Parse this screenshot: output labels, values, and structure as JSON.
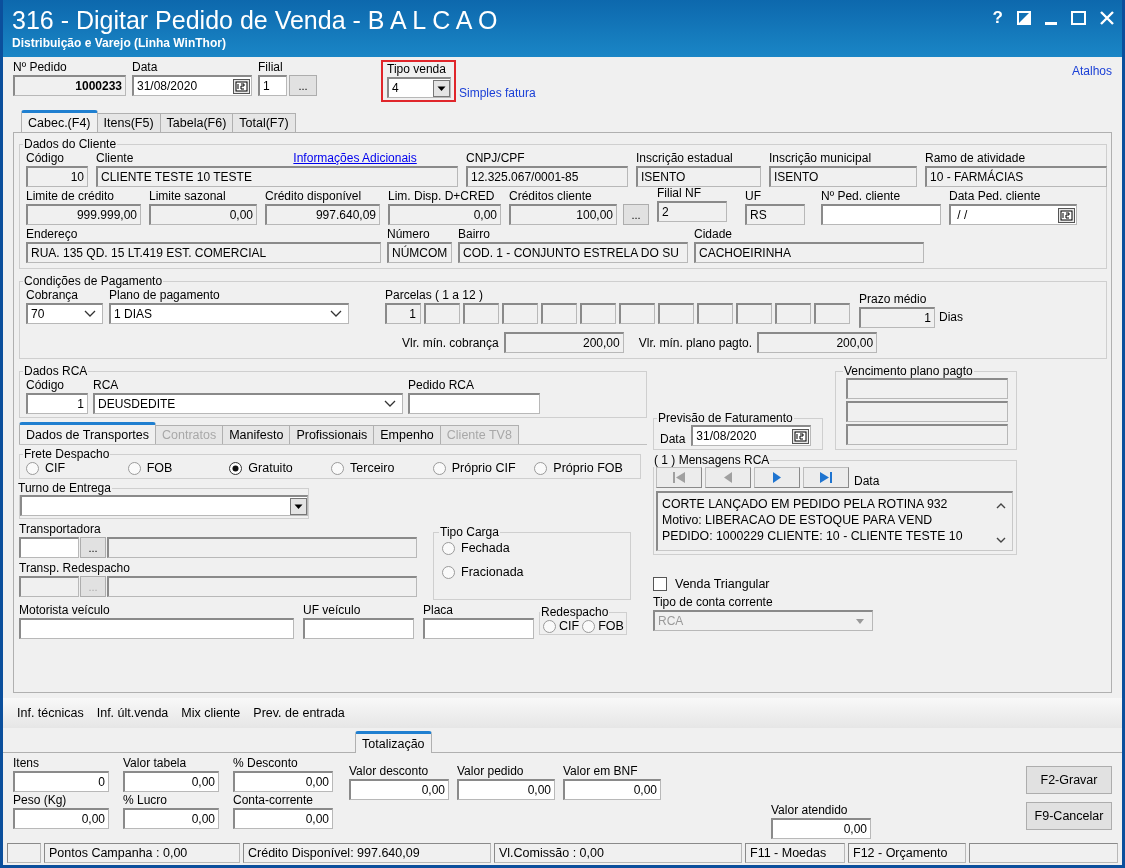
{
  "window": {
    "title": "316 - Digitar Pedido de Venda - B A L C A O",
    "subtitle": "Distribuição e Varejo (Linha WinThor)",
    "help": "?"
  },
  "header": {
    "numero": {
      "label": "Nº Pedido",
      "value": "1000233",
      "readonly": true
    },
    "data": {
      "label": "Data",
      "value": "31/08/2020",
      "kind": "date"
    },
    "filial": {
      "label": "Filial",
      "value": "1"
    },
    "lookup_button": "...",
    "tipo_venda": {
      "label": "Tipo venda",
      "value": "4",
      "kind": "dropdown",
      "description": "Simples fatura"
    },
    "atalhos": "Atalhos"
  },
  "tabs": [
    {
      "label": "Cabec.(F4)",
      "selected": true
    },
    {
      "label": "Itens(F5)",
      "selected": false
    },
    {
      "label": "Tabela(F6)",
      "selected": false
    },
    {
      "label": "Total(F7)",
      "selected": false
    }
  ],
  "cliente": {
    "title": "Dados do Cliente",
    "link": "Informações Adicionais",
    "lookup_button": "...",
    "fields": [
      {
        "label": "Código",
        "value": "10",
        "kind": "text",
        "readonly": true
      },
      {
        "label": "Cliente",
        "value": "CLIENTE TESTE 10 TESTE",
        "kind": "text",
        "readonly": true
      },
      {
        "label": "CNPJ/CPF",
        "value": "12.325.067/0001-85",
        "kind": "text",
        "readonly": true
      },
      {
        "label": "Inscrição estadual",
        "value": "ISENTO",
        "kind": "text",
        "readonly": true
      },
      {
        "label": "Inscrição municipal",
        "value": "ISENTO",
        "kind": "text",
        "readonly": true
      },
      {
        "label": "Ramo de atividade",
        "value": "10 - FARMÁCIAS",
        "kind": "text",
        "readonly": true
      },
      {
        "label": "Limite de crédito",
        "value": "999.999,00",
        "kind": "text",
        "readonly": true
      },
      {
        "label": "Limite sazonal",
        "value": "0,00",
        "kind": "text",
        "readonly": true
      },
      {
        "label": "Crédito disponível",
        "value": "997.640,09",
        "kind": "text",
        "readonly": true
      },
      {
        "label": "Lim. Disp. D+CRED",
        "value": "0,00",
        "kind": "text",
        "readonly": true
      },
      {
        "label": "Créditos cliente",
        "value": "100,00",
        "kind": "text",
        "readonly": true
      },
      {
        "label": "Filial NF",
        "value": "2",
        "kind": "text",
        "readonly": true
      },
      {
        "label": "UF",
        "value": "RS",
        "kind": "text",
        "readonly": true
      },
      {
        "label": "Nº Ped. cliente",
        "kind": "text",
        "readonly": false
      },
      {
        "label": "Data Ped. cliente",
        "value": " / /",
        "kind": "date",
        "readonly": false
      },
      {
        "label": "Endereço",
        "value": "RUA. 135 QD. 15 LT.419 EST. COMERCIAL",
        "kind": "text",
        "readonly": true
      },
      {
        "label": "Número",
        "value": "NÚMCOM",
        "kind": "text",
        "readonly": true
      },
      {
        "label": "Bairro",
        "value": "COD. 1 - CONJUNTO ESTRELA DO SU",
        "kind": "text",
        "readonly": true
      },
      {
        "label": "Cidade",
        "value": "CACHOEIRINHA",
        "kind": "text",
        "readonly": true
      }
    ]
  },
  "pagamento": {
    "title": "Condições de Pagamento",
    "cobranca": {
      "label": "Cobrança",
      "value": "70",
      "kind": "combo"
    },
    "plano": {
      "label": "Plano de pagamento",
      "value": "1 DIAS",
      "kind": "combo"
    },
    "parcelas": {
      "label": "Parcelas ( 1 a 12 )",
      "values": [
        "1"
      ]
    },
    "prazo": {
      "label": "Prazo médio",
      "value": "1",
      "readonly": true,
      "unit": "Dias"
    },
    "vlr_cobranca": {
      "label": "Vlr. mín. cobrança",
      "value": "200,00",
      "readonly": true
    },
    "vlr_plano": {
      "label": "Vlr. mín. plano pagto.",
      "value": "200,00",
      "readonly": true
    }
  },
  "rca": {
    "title": "Dados RCA",
    "codigo": {
      "label": "Código",
      "value": "1"
    },
    "rca": {
      "label": "RCA",
      "value": "DEUSDEDITE",
      "kind": "combo"
    },
    "pedido": {
      "label": "Pedido RCA"
    }
  },
  "transport_tabs": [
    {
      "label": "Dados de Transportes",
      "selected": true,
      "disabled": false
    },
    {
      "label": "Contratos",
      "selected": false,
      "disabled": true
    },
    {
      "label": "Manifesto",
      "selected": false,
      "disabled": false
    },
    {
      "label": "Profissionais",
      "selected": false,
      "disabled": false
    },
    {
      "label": "Empenho",
      "selected": false,
      "disabled": false
    },
    {
      "label": "Cliente TV8",
      "selected": false,
      "disabled": true
    }
  ],
  "frete": {
    "title": "Frete Despacho",
    "options": [
      {
        "label": "CIF",
        "selected": false
      },
      {
        "label": "FOB",
        "selected": false
      },
      {
        "label": "Gratuito",
        "selected": true
      },
      {
        "label": "Terceiro",
        "selected": false
      },
      {
        "label": "Próprio CIF",
        "selected": false
      },
      {
        "label": "Próprio FOB",
        "selected": false
      }
    ]
  },
  "turno": {
    "title": "Turno de Entrega",
    "field": {
      "kind": "dropdown"
    }
  },
  "transportadora": {
    "label": "Transportadora",
    "button": "...",
    "disabled": false
  },
  "transp_redespacho": {
    "label": "Transp. Redespacho",
    "button": "...",
    "disabled": true
  },
  "tipo_carga": {
    "title": "Tipo Carga",
    "options": [
      {
        "label": "Fechada",
        "selected": false
      },
      {
        "label": "Fracionada",
        "selected": false
      }
    ]
  },
  "motorista": {
    "label": "Motorista veículo"
  },
  "uf_veiculo": {
    "label": "UF veículo"
  },
  "placa": {
    "label": "Placa"
  },
  "redespacho": {
    "title": "Redespacho",
    "options": [
      {
        "label": "CIF",
        "selected": false
      },
      {
        "label": "FOB",
        "selected": false
      }
    ]
  },
  "vencimento": {
    "title": "Vencimento plano pagto"
  },
  "previsao": {
    "title": "Previsão de Faturamento",
    "field": {
      "label": "Data",
      "value": "31/08/2020",
      "kind": "date"
    }
  },
  "mensagens": {
    "title": "( 1 ) Mensagens RCA",
    "label": "Data",
    "nav": [
      {
        "kind": "first",
        "disabled": true
      },
      {
        "kind": "prev",
        "disabled": true
      },
      {
        "kind": "next",
        "disabled": false
      },
      {
        "kind": "last",
        "disabled": false
      }
    ],
    "lines": [
      "CORTE LANÇADO EM PEDIDO PELA ROTINA 932",
      "Motivo: LIBERACAO DE ESTOQUE PARA VEND",
      "PEDIDO: 1000229 CLIENTE: 10 - CLIENTE TESTE 10"
    ]
  },
  "venda_triangular": {
    "label": "Venda Triangular",
    "checked": false
  },
  "conta_corrente": {
    "label": "Tipo de conta corrente",
    "value": "RCA",
    "kind": "combo",
    "disabled": true
  },
  "links": [
    "Inf. técnicas",
    "Inf. últ.venda",
    "Mix cliente",
    "Prev. de entrada"
  ],
  "totalizacao": {
    "tab": "Totalização",
    "fields": [
      {
        "label": "Itens",
        "value": "0"
      },
      {
        "label": "Valor tabela",
        "value": "0,00"
      },
      {
        "label": "% Desconto",
        "value": "0,00"
      },
      {
        "label": "Valor desconto",
        "value": "0,00"
      },
      {
        "label": "Valor pedido",
        "value": "0,00"
      },
      {
        "label": "Valor em BNF",
        "value": "0,00"
      },
      {
        "label": "Peso (Kg)",
        "value": "0,00"
      },
      {
        "label": "% Lucro",
        "value": "0,00"
      },
      {
        "label": "Conta-corrente",
        "value": "0,00"
      },
      {
        "label": "Valor atendido",
        "value": "0,00"
      }
    ],
    "buttons": [
      "F2-Gravar",
      "F9-Cancelar"
    ]
  },
  "status_bar": [
    "Pontos Campanha : 0,00",
    "Crédito Disponível: 997.640,09",
    "Vl.Comissão : 0,00",
    "F11 - Moedas",
    "F12 - Orçamento"
  ]
}
